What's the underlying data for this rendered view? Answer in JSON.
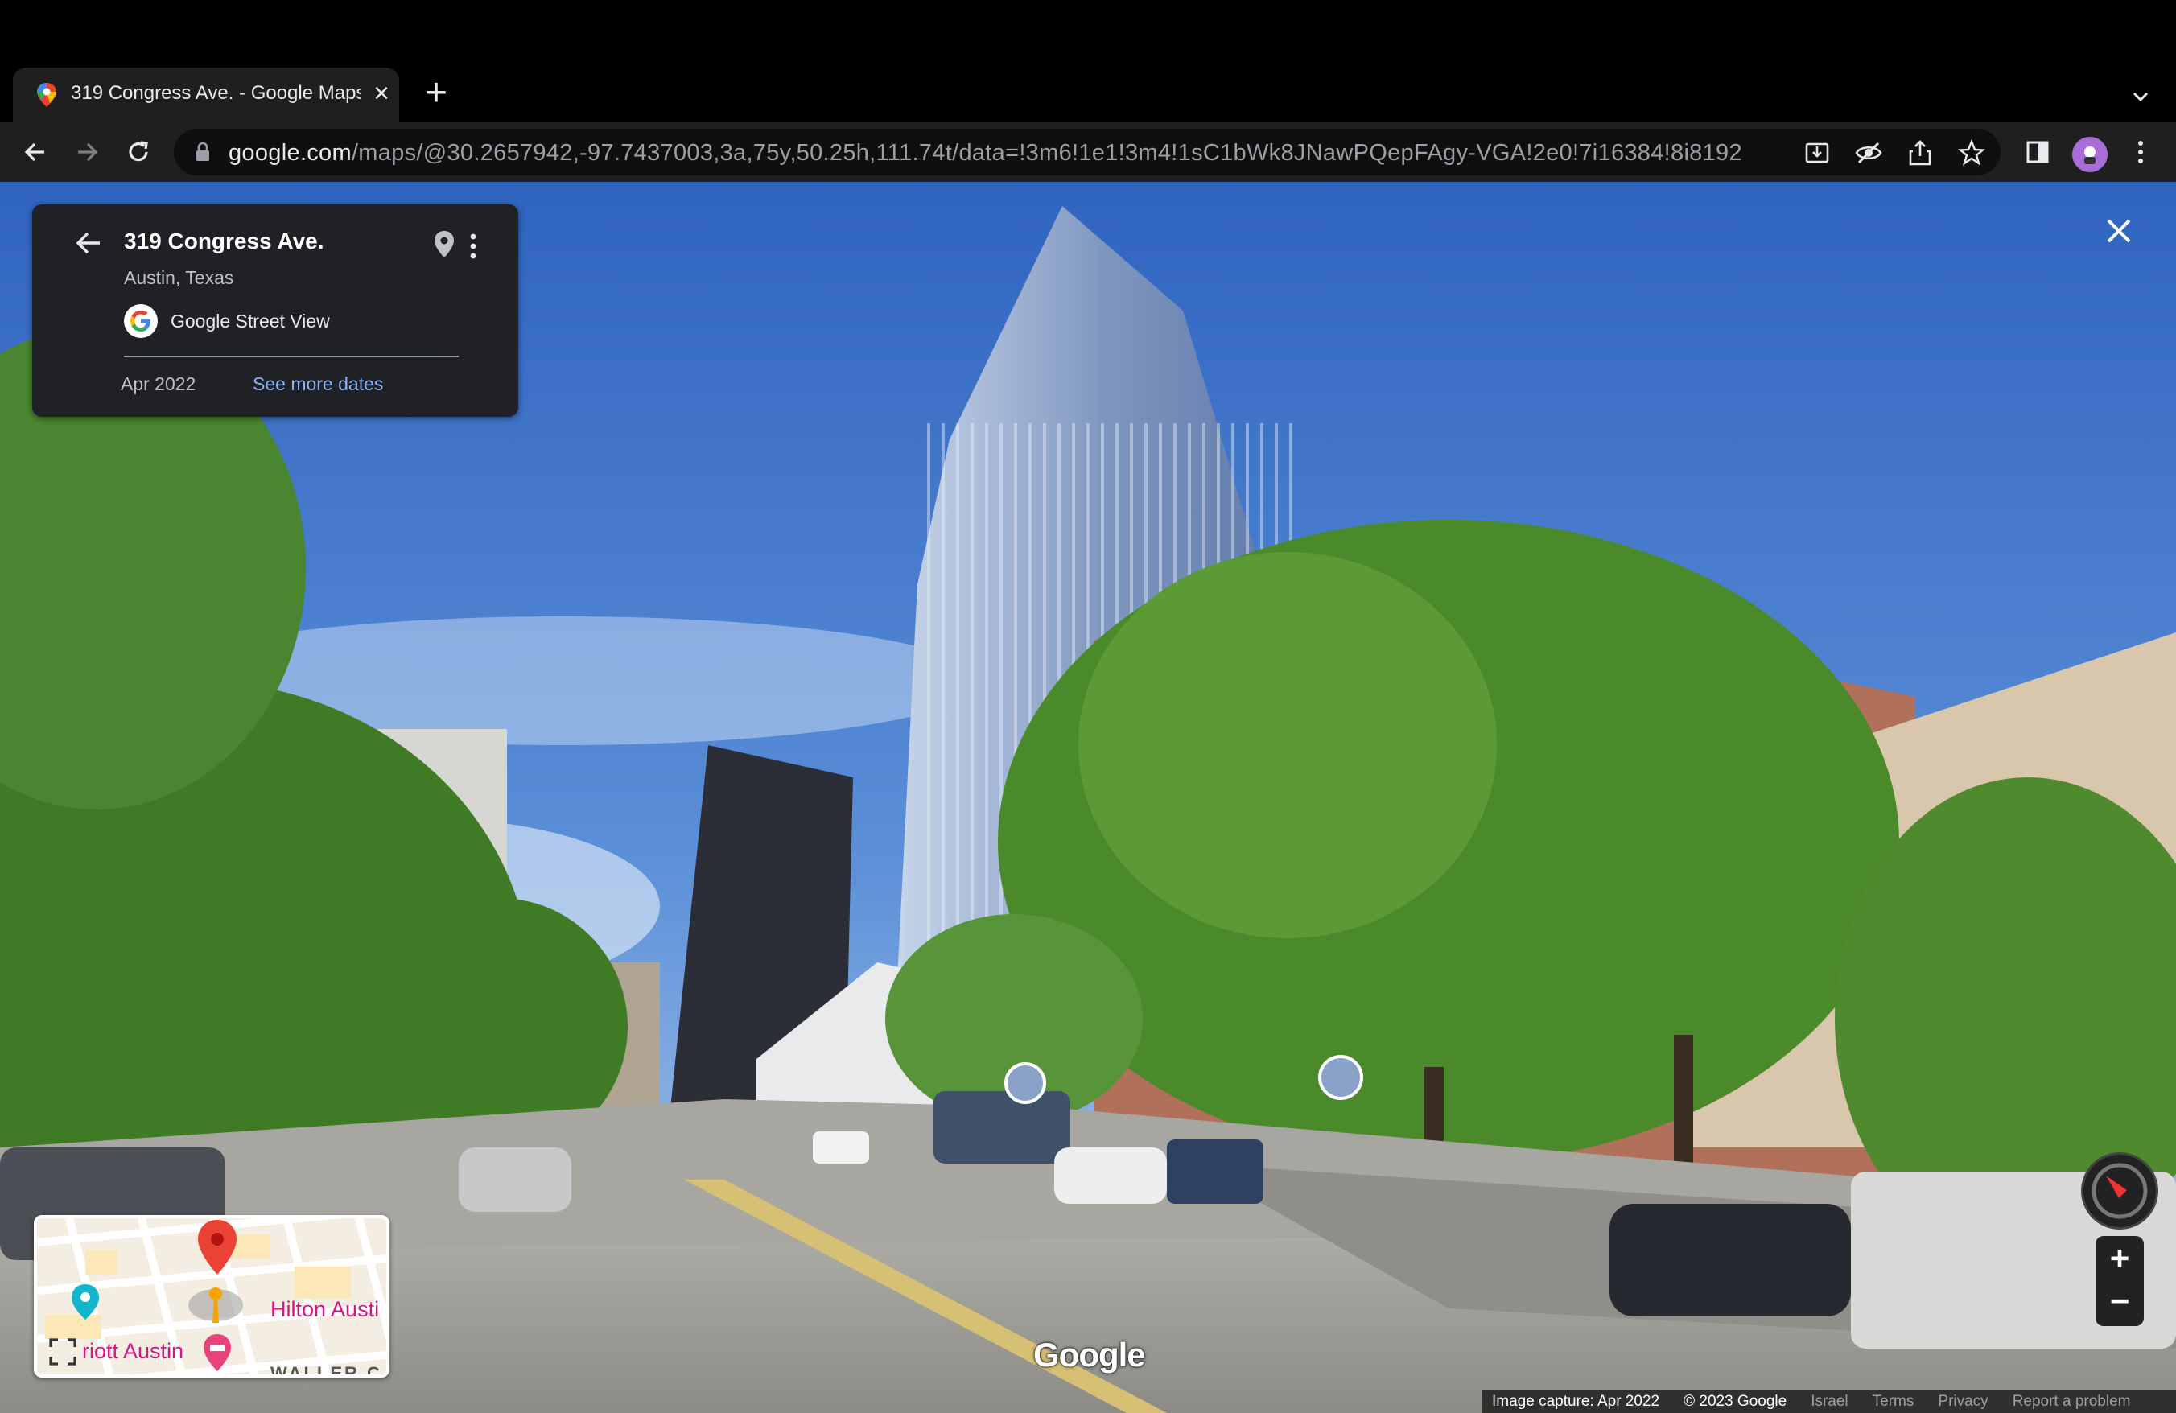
{
  "browser": {
    "tab_title": "319 Congress Ave. - Google Maps",
    "new_tab_icon": "plus-icon",
    "url_host": "google.com",
    "url_path": "/maps/@30.2657942,-97.7437003,3a,75y,50.25h,111.74t/data=!3m6!1e1!3m4!1sC1bWk8JNawPQepFAgy-VGA!2e0!7i16384!8i8192"
  },
  "info_card": {
    "title": "319 Congress Ave.",
    "subtitle": "Austin, Texas",
    "source": "Google Street View",
    "capture_date": "Apr 2022",
    "more_dates": "See more dates"
  },
  "minimap": {
    "label_hotel_1": "Hilton Austi",
    "label_hotel_2": "riott Austin",
    "street": "WALLER C"
  },
  "controls": {
    "zoom_in": "+",
    "zoom_out": "−"
  },
  "watermark": "Google",
  "footer": {
    "capture": "Image capture: Apr 2022",
    "copyright": "© 2023 Google",
    "country": "Israel",
    "terms": "Terms",
    "privacy": "Privacy",
    "report": "Report a problem"
  },
  "colors": {
    "sky": "#3d72c9",
    "foliage": "#4f8a2e",
    "road": "#9a9a98",
    "tower_glass": "#8fa6c8",
    "accent_link": "#8ab4f8"
  }
}
